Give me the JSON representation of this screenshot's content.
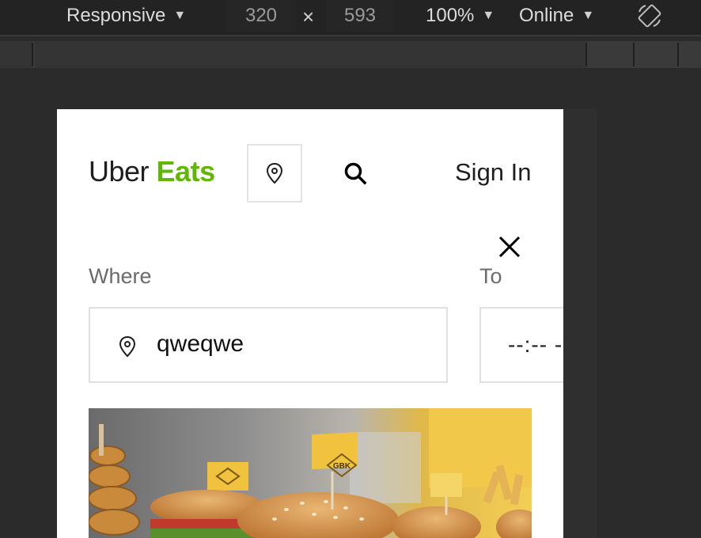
{
  "devtools": {
    "device": "Responsive",
    "width": "320",
    "times": "×",
    "height": "593",
    "zoom": "100%",
    "network": "Online",
    "caret": "▼",
    "icons": {
      "rotate": "rotate-icon"
    }
  },
  "page": {
    "logo": {
      "uber": "Uber",
      "eats": "Eats"
    },
    "header": {
      "sign_in": "Sign In"
    },
    "where": {
      "label": "Where",
      "value": "qweqwe"
    },
    "to": {
      "label": "To",
      "value": "--:-- -"
    },
    "hero_flag": "GBK",
    "colors": {
      "brand_green": "#5fb709",
      "text": "#1f1f1f",
      "label": "#6b6b6b",
      "border": "#e0e0e0"
    },
    "icons": {
      "location": "location-pin-icon",
      "search": "search-icon",
      "close": "close-icon"
    }
  }
}
